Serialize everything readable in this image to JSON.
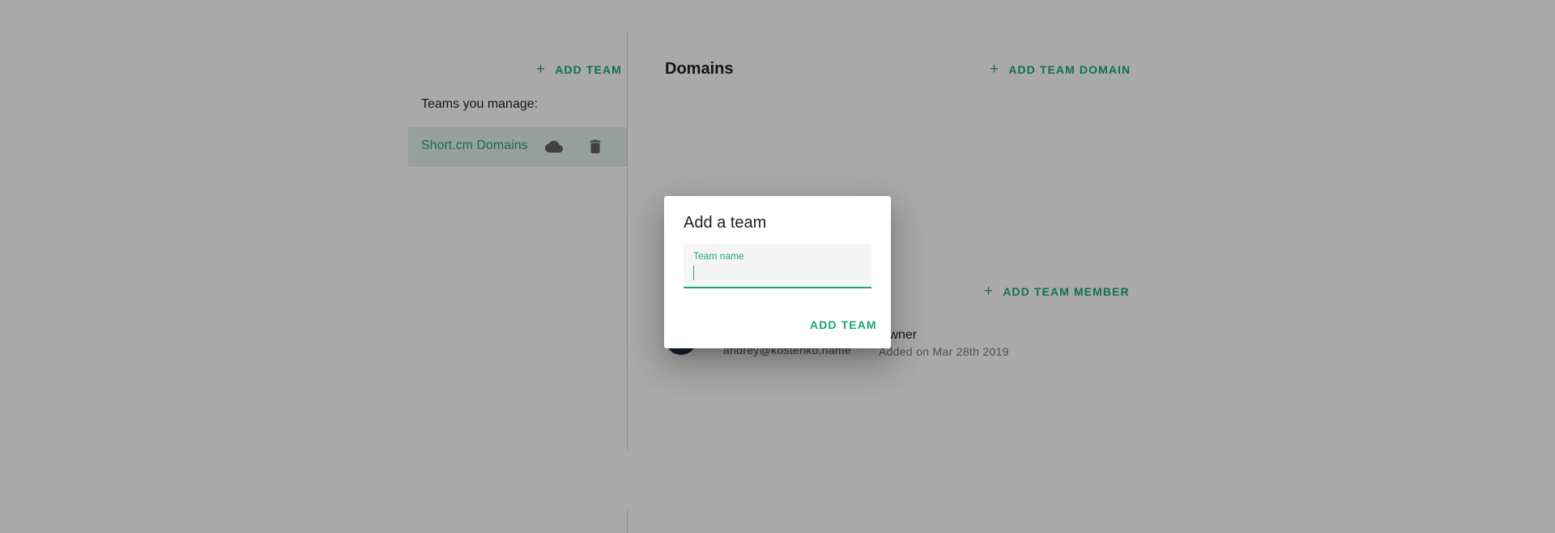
{
  "sidebar": {
    "add_team_label": "ADD TEAM",
    "teams_label": "Teams you manage:",
    "teams": [
      {
        "name": "Short.cm Domains",
        "icons": [
          "cloud-icon",
          "trash-icon"
        ]
      }
    ]
  },
  "main": {
    "domains_title": "Domains",
    "add_domain_label": "ADD TEAM DOMAIN",
    "add_member_label": "ADD TEAM MEMBER",
    "members": [
      {
        "email": "andrey@kostenko.name",
        "role": "Owner",
        "added": "Added on Mar 28th 2019"
      }
    ]
  },
  "dialog": {
    "title": "Add a team",
    "field_label": "Team name",
    "field_value": "",
    "action_label": "ADD TEAM"
  },
  "colors": {
    "accent": "#1aa574",
    "overlay": "rgba(0,0,0,0.32)",
    "selected_row": "#e0ece7"
  }
}
